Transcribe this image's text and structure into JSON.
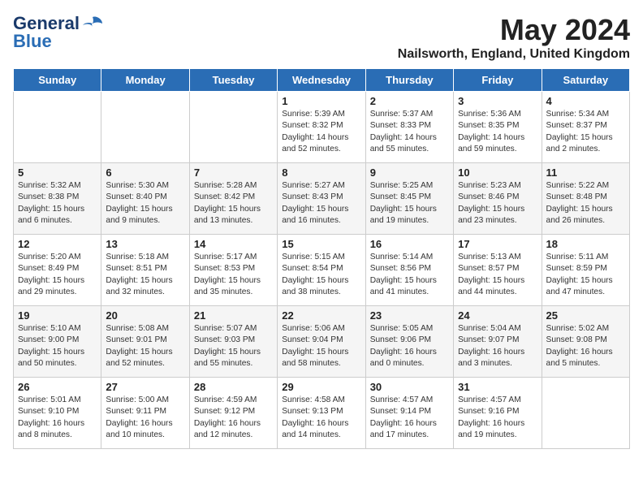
{
  "logo": {
    "line1": "General",
    "line2": "Blue"
  },
  "title": "May 2024",
  "location": "Nailsworth, England, United Kingdom",
  "weekdays": [
    "Sunday",
    "Monday",
    "Tuesday",
    "Wednesday",
    "Thursday",
    "Friday",
    "Saturday"
  ],
  "weeks": [
    [
      {
        "day": "",
        "info": ""
      },
      {
        "day": "",
        "info": ""
      },
      {
        "day": "",
        "info": ""
      },
      {
        "day": "1",
        "info": "Sunrise: 5:39 AM\nSunset: 8:32 PM\nDaylight: 14 hours and 52 minutes."
      },
      {
        "day": "2",
        "info": "Sunrise: 5:37 AM\nSunset: 8:33 PM\nDaylight: 14 hours and 55 minutes."
      },
      {
        "day": "3",
        "info": "Sunrise: 5:36 AM\nSunset: 8:35 PM\nDaylight: 14 hours and 59 minutes."
      },
      {
        "day": "4",
        "info": "Sunrise: 5:34 AM\nSunset: 8:37 PM\nDaylight: 15 hours and 2 minutes."
      }
    ],
    [
      {
        "day": "5",
        "info": "Sunrise: 5:32 AM\nSunset: 8:38 PM\nDaylight: 15 hours and 6 minutes."
      },
      {
        "day": "6",
        "info": "Sunrise: 5:30 AM\nSunset: 8:40 PM\nDaylight: 15 hours and 9 minutes."
      },
      {
        "day": "7",
        "info": "Sunrise: 5:28 AM\nSunset: 8:42 PM\nDaylight: 15 hours and 13 minutes."
      },
      {
        "day": "8",
        "info": "Sunrise: 5:27 AM\nSunset: 8:43 PM\nDaylight: 15 hours and 16 minutes."
      },
      {
        "day": "9",
        "info": "Sunrise: 5:25 AM\nSunset: 8:45 PM\nDaylight: 15 hours and 19 minutes."
      },
      {
        "day": "10",
        "info": "Sunrise: 5:23 AM\nSunset: 8:46 PM\nDaylight: 15 hours and 23 minutes."
      },
      {
        "day": "11",
        "info": "Sunrise: 5:22 AM\nSunset: 8:48 PM\nDaylight: 15 hours and 26 minutes."
      }
    ],
    [
      {
        "day": "12",
        "info": "Sunrise: 5:20 AM\nSunset: 8:49 PM\nDaylight: 15 hours and 29 minutes."
      },
      {
        "day": "13",
        "info": "Sunrise: 5:18 AM\nSunset: 8:51 PM\nDaylight: 15 hours and 32 minutes."
      },
      {
        "day": "14",
        "info": "Sunrise: 5:17 AM\nSunset: 8:53 PM\nDaylight: 15 hours and 35 minutes."
      },
      {
        "day": "15",
        "info": "Sunrise: 5:15 AM\nSunset: 8:54 PM\nDaylight: 15 hours and 38 minutes."
      },
      {
        "day": "16",
        "info": "Sunrise: 5:14 AM\nSunset: 8:56 PM\nDaylight: 15 hours and 41 minutes."
      },
      {
        "day": "17",
        "info": "Sunrise: 5:13 AM\nSunset: 8:57 PM\nDaylight: 15 hours and 44 minutes."
      },
      {
        "day": "18",
        "info": "Sunrise: 5:11 AM\nSunset: 8:59 PM\nDaylight: 15 hours and 47 minutes."
      }
    ],
    [
      {
        "day": "19",
        "info": "Sunrise: 5:10 AM\nSunset: 9:00 PM\nDaylight: 15 hours and 50 minutes."
      },
      {
        "day": "20",
        "info": "Sunrise: 5:08 AM\nSunset: 9:01 PM\nDaylight: 15 hours and 52 minutes."
      },
      {
        "day": "21",
        "info": "Sunrise: 5:07 AM\nSunset: 9:03 PM\nDaylight: 15 hours and 55 minutes."
      },
      {
        "day": "22",
        "info": "Sunrise: 5:06 AM\nSunset: 9:04 PM\nDaylight: 15 hours and 58 minutes."
      },
      {
        "day": "23",
        "info": "Sunrise: 5:05 AM\nSunset: 9:06 PM\nDaylight: 16 hours and 0 minutes."
      },
      {
        "day": "24",
        "info": "Sunrise: 5:04 AM\nSunset: 9:07 PM\nDaylight: 16 hours and 3 minutes."
      },
      {
        "day": "25",
        "info": "Sunrise: 5:02 AM\nSunset: 9:08 PM\nDaylight: 16 hours and 5 minutes."
      }
    ],
    [
      {
        "day": "26",
        "info": "Sunrise: 5:01 AM\nSunset: 9:10 PM\nDaylight: 16 hours and 8 minutes."
      },
      {
        "day": "27",
        "info": "Sunrise: 5:00 AM\nSunset: 9:11 PM\nDaylight: 16 hours and 10 minutes."
      },
      {
        "day": "28",
        "info": "Sunrise: 4:59 AM\nSunset: 9:12 PM\nDaylight: 16 hours and 12 minutes."
      },
      {
        "day": "29",
        "info": "Sunrise: 4:58 AM\nSunset: 9:13 PM\nDaylight: 16 hours and 14 minutes."
      },
      {
        "day": "30",
        "info": "Sunrise: 4:57 AM\nSunset: 9:14 PM\nDaylight: 16 hours and 17 minutes."
      },
      {
        "day": "31",
        "info": "Sunrise: 4:57 AM\nSunset: 9:16 PM\nDaylight: 16 hours and 19 minutes."
      },
      {
        "day": "",
        "info": ""
      }
    ]
  ]
}
